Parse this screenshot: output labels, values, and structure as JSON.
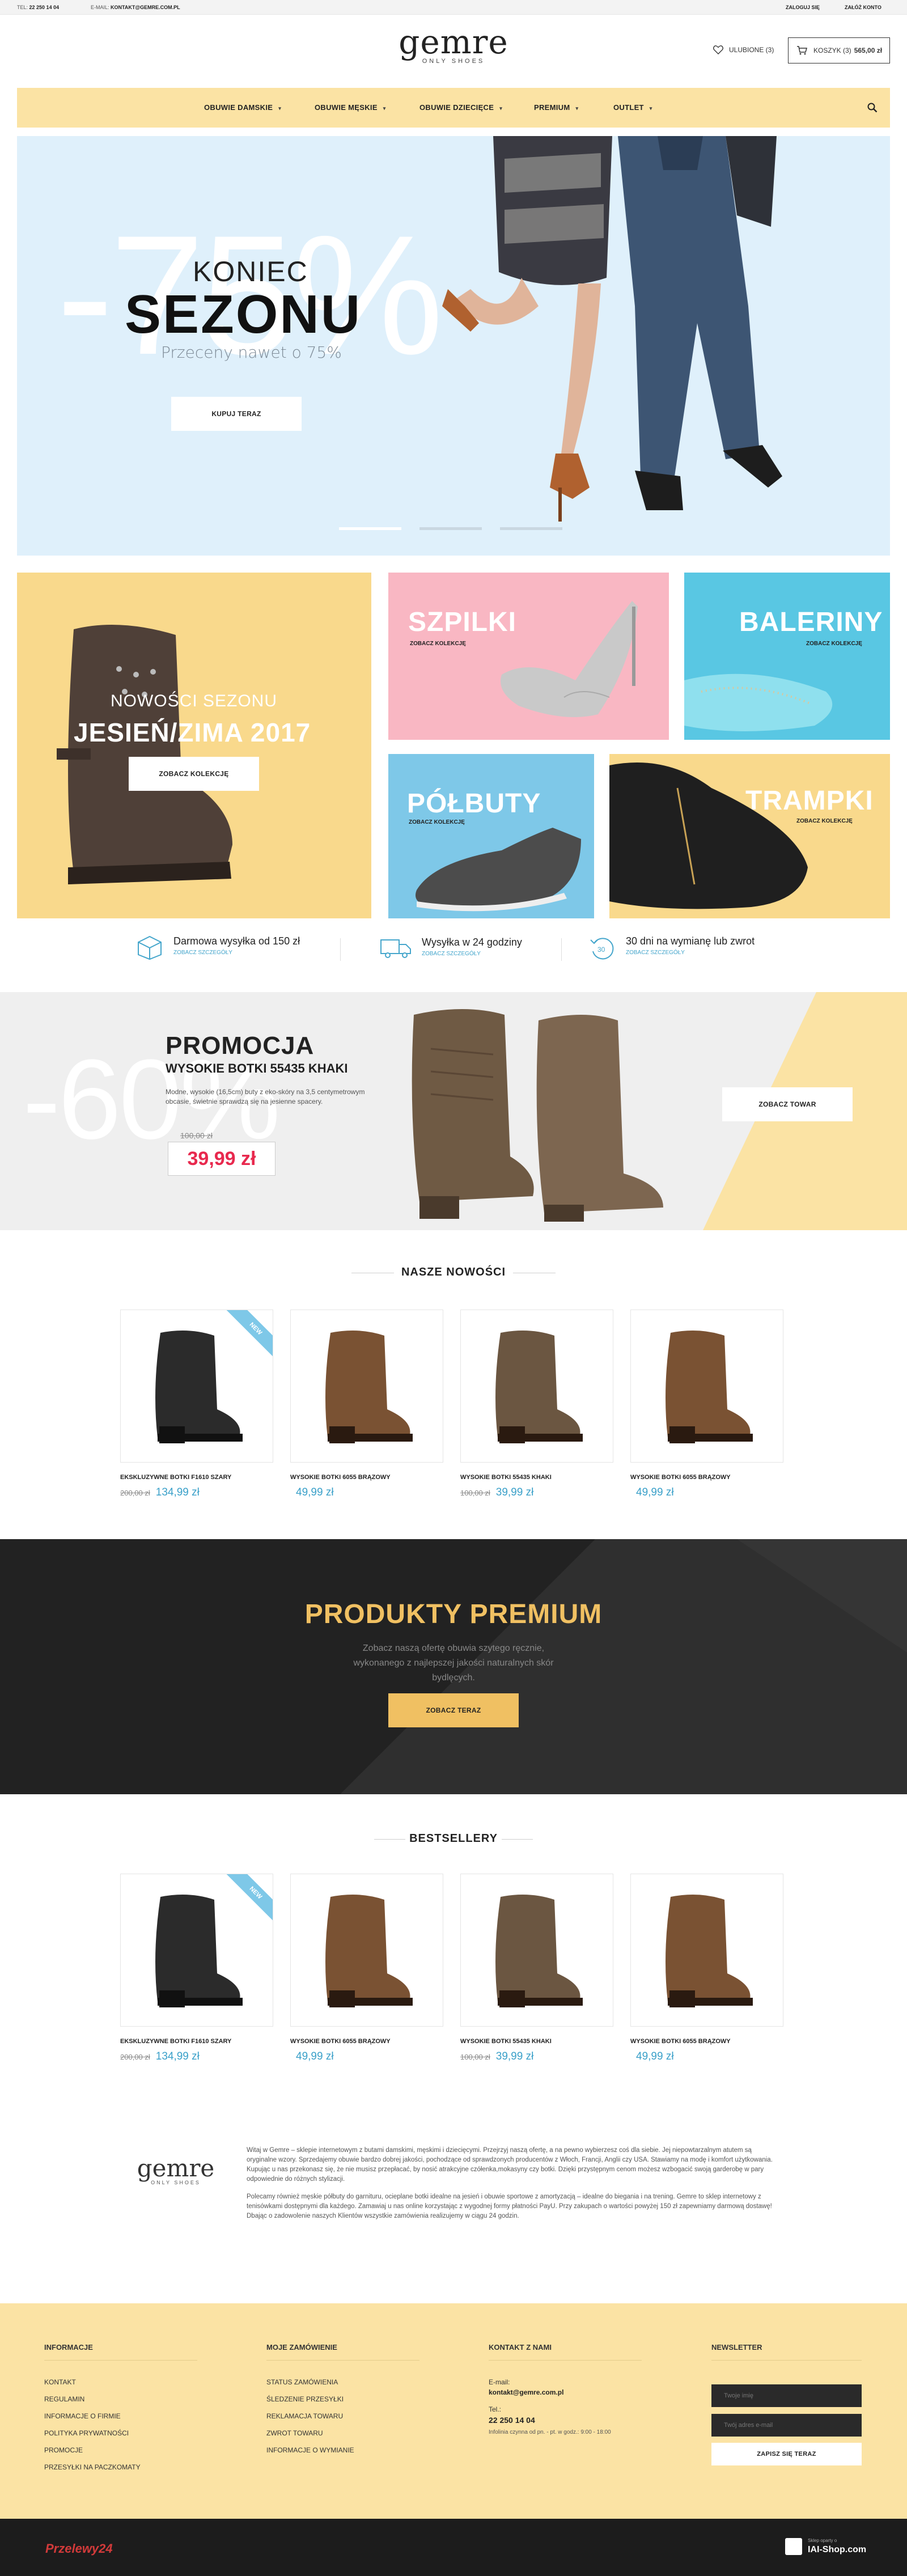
{
  "topbar": {
    "phone_label": "TEL:",
    "phone": "22 250 14 04",
    "email_label": "E-MAIL:",
    "email": "KONTAKT@GEMRE.COM.PL",
    "login": "ZALOGUJ SIĘ",
    "register": "ZAŁÓŻ KONTO"
  },
  "header": {
    "logo": "gemre",
    "logo_sub": "ONLY SHOES",
    "favorites": "ULUBIONE (3)",
    "cart_label": "KOSZYK (3)",
    "cart_total": "565,00 zł"
  },
  "nav": {
    "items": [
      "OBUWIE DAMSKIE",
      "OBUWIE MĘSKIE",
      "OBUWIE DZIECIĘCE",
      "PREMIUM",
      "OUTLET"
    ]
  },
  "hero": {
    "bg_text": "-75%",
    "line1": "KONIEC",
    "line2": "SEZONU",
    "subtitle": "Przeceny nawet o 75%",
    "button": "KUPUJ TERAZ"
  },
  "tiles": {
    "season_title": "NOWOŚCI SEZONU",
    "season_name": "JESIEŃ/ZIMA 2017",
    "season_button": "ZOBACZ KOLEKCJĘ",
    "szpilki": "SZPILKI",
    "baleriny": "BALERINY",
    "polbuty": "PÓŁBUTY",
    "trampki": "TRAMPKI",
    "see_collection": "ZOBACZ KOLEKCJĘ"
  },
  "benefits": [
    {
      "title": "Darmowa wysyłka od 150 zł",
      "link": "ZOBACZ SZCZEGÓŁY",
      "icon": "box-icon"
    },
    {
      "title": "Wysyłka w 24 godziny",
      "link": "ZOBACZ SZCZEGÓŁY",
      "icon": "truck-icon"
    },
    {
      "title": "30 dni na wymianę lub zwrot",
      "link": "ZOBACZ SZCZEGÓŁY",
      "icon": "return-icon"
    }
  ],
  "promo": {
    "bg_text": "-60%",
    "title": "PROMOCJA",
    "product": "WYSOKIE BOTKI 55435 KHAKI",
    "description": "Modne, wysokie (16,5cm) buty z eko-skóry na 3,5 centymetrowym obcasie, świetnie sprawdzą się na jesienne spacery.",
    "old_price": "100,00 zł",
    "price": "39,99 zł",
    "button": "ZOBACZ TOWAR"
  },
  "new_section": {
    "title": "NASZE NOWOŚCI",
    "badge": "NEW",
    "products": [
      {
        "name": "EKSKLUZYWNE BOTKI F1610 SZARY",
        "old": "200,00 zł",
        "price": "134,99 zł"
      },
      {
        "name": "WYSOKIE BOTKI 6055 BRĄZOWY",
        "old": "",
        "price": "49,99 zł"
      },
      {
        "name": "WYSOKIE BOTKI 55435 KHAKI",
        "old": "100,00 zł",
        "price": "39,99 zł"
      },
      {
        "name": "WYSOKIE BOTKI 6055 BRĄZOWY",
        "old": "",
        "price": "49,99 zł"
      }
    ]
  },
  "premium": {
    "title": "PRODUKTY PREMIUM",
    "text": "Zobacz naszą ofertę obuwia szytego ręcznie, wykonanego z najlepszej jakości naturalnych skór bydlęcych.",
    "button": "ZOBACZ TERAZ"
  },
  "best_section": {
    "title": "BESTSELLERY",
    "badge": "NEW",
    "products": [
      {
        "name": "EKSKLUZYWNE BOTKI F1610 SZARY",
        "old": "200,00 zł",
        "price": "134,99 zł"
      },
      {
        "name": "WYSOKIE BOTKI 6055 BRĄZOWY",
        "old": "",
        "price": "49,99 zł"
      },
      {
        "name": "WYSOKIE BOTKI 55435 KHAKI",
        "old": "100,00 zł",
        "price": "39,99 zł"
      },
      {
        "name": "WYSOKIE BOTKI 6055 BRĄZOWY",
        "old": "",
        "price": "49,99 zł"
      }
    ]
  },
  "about": {
    "p1": "Witaj w Gemre – sklepie internetowym z butami damskimi, męskimi i dziecięcymi. Przejrzyj naszą ofertę, a na pewno wybierzesz coś dla siebie. Jej niepowtarzalnym atutem są oryginalne wzory. Sprzedajemy obuwie bardzo dobrej jakości, pochodzące od sprawdzonych producentów z Włoch, Francji, Anglii czy USA. Stawiamy na modę i komfort użytkowania. Kupując u nas przekonasz się, że nie musisz przepłacać, by nosić atrakcyjne czółenka,mokasyny czy botki. Dzięki przystępnym cenom możesz wzbogacić swoją garderobę w pary odpowiednie do różnych stylizacji.",
    "p2": "Polecamy również męskie półbuty do garnituru, ocieplane botki idealne na jesień i obuwie sportowe z amortyzacją – idealne do biegania i na trening. Gemre to sklep internetowy z tenisówkami dostępnymi dla każdego. Zamawiaj u nas online korzystając z wygodnej formy płatności PayU. Przy zakupach o wartości powyżej 150 zł zapewniamy darmową dostawę! Dbając o zadowolenie naszych Klientów wszystkie zamówienia realizujemy w ciągu 24 godzin."
  },
  "footer": {
    "col1_title": "INFORMACJE",
    "col1_links": [
      "KONTAKT",
      "REGULAMIN",
      "INFORMACJE O FIRMIE",
      "POLITYKA PRYWATNOŚCI",
      "PROMOCJE",
      "PRZESYŁKI NA PACZKOMATY"
    ],
    "col2_title": "MOJE ZAMÓWIENIE",
    "col2_links": [
      "STATUS ZAMÓWIENIA",
      "ŚLEDZENIE PRZESYŁKI",
      "REKLAMACJA TOWARU",
      "ZWROT TOWARU",
      "INFORMACJE O WYMIANIE"
    ],
    "col3_title": "KONTAKT Z NAMI",
    "email_label": "E-mail:",
    "email": "kontakt@gemre.com.pl",
    "tel_label": "Tel.:",
    "tel": "22 250 14 04",
    "hours": "Infolinia czynna od pn. - pt. w godz.: 9:00 - 18:00",
    "col4_title": "NEWSLETTER",
    "name_placeholder": "Twoje imię",
    "email_placeholder": "Twój adres e-mail",
    "subscribe": "ZAPISZ SIĘ TERAZ"
  },
  "bottombar": {
    "payment_logo": "Przelewy24",
    "iai_small": "Sklep oparty o",
    "iai": "IAI-Shop.com"
  },
  "colors": {
    "accent": "#fbe3a4",
    "price_blue": "#3aa0c9",
    "promo_red": "#e8294e",
    "premium_gold": "#f0c062",
    "tile_yellow": "#f9d98c",
    "tile_pink": "#f9b7c3",
    "tile_cyan": "#59c7e3",
    "tile_blue": "#7ec8e8"
  }
}
